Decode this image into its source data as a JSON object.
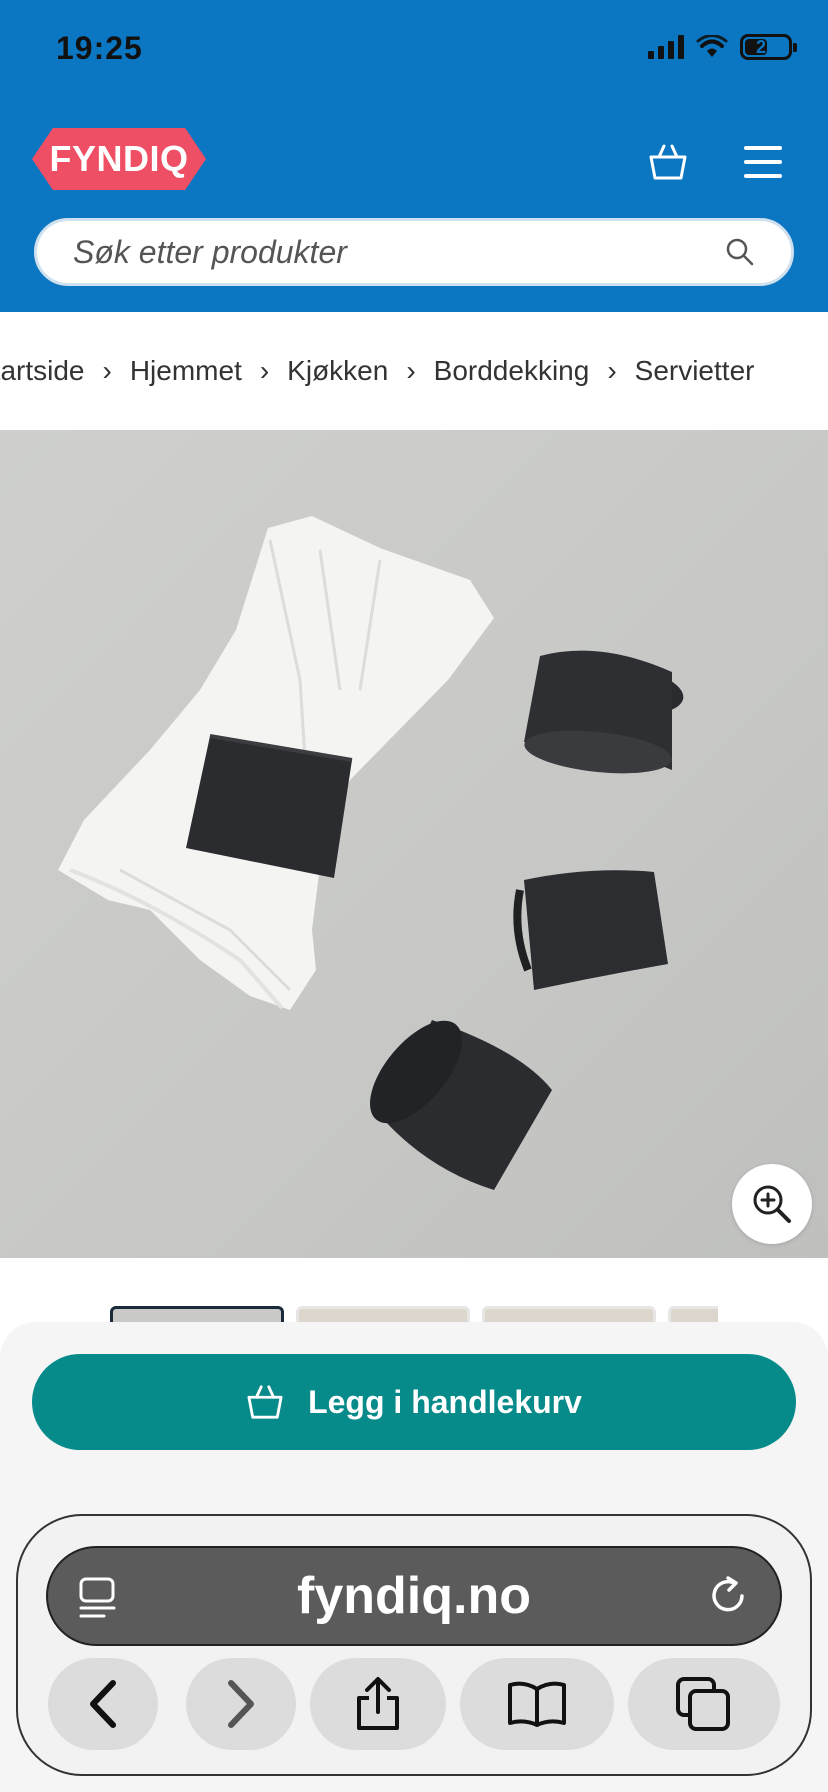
{
  "status": {
    "time": "19:25",
    "battery": "25"
  },
  "header": {
    "logo_text": "FYNDIQ",
    "cart_icon": "basket-icon",
    "menu_icon": "hamburger-icon"
  },
  "search": {
    "placeholder": "Søk etter produkter",
    "icon": "search-icon"
  },
  "breadcrumb": {
    "items": [
      "Startside",
      "Hjemmet",
      "Kjøkken",
      "Borddekking",
      "Servietter"
    ],
    "separator": "›"
  },
  "product": {
    "image": "napkin-rings-photo",
    "zoom_icon": "zoom-in-icon",
    "thumbnail_count": 4
  },
  "actions": {
    "add_to_cart_label": "Legg i handlekurv",
    "accent_color": "#078a8a"
  },
  "browser": {
    "url": "fyndiq.no",
    "reader_icon": "reader-icon",
    "reload_icon": "reload-icon",
    "nav": [
      "back-icon",
      "forward-icon",
      "share-icon",
      "bookmarks-icon",
      "tabs-icon"
    ]
  },
  "colors": {
    "header_bg": "#0b77c2",
    "logo_bg": "#ef4f64"
  }
}
